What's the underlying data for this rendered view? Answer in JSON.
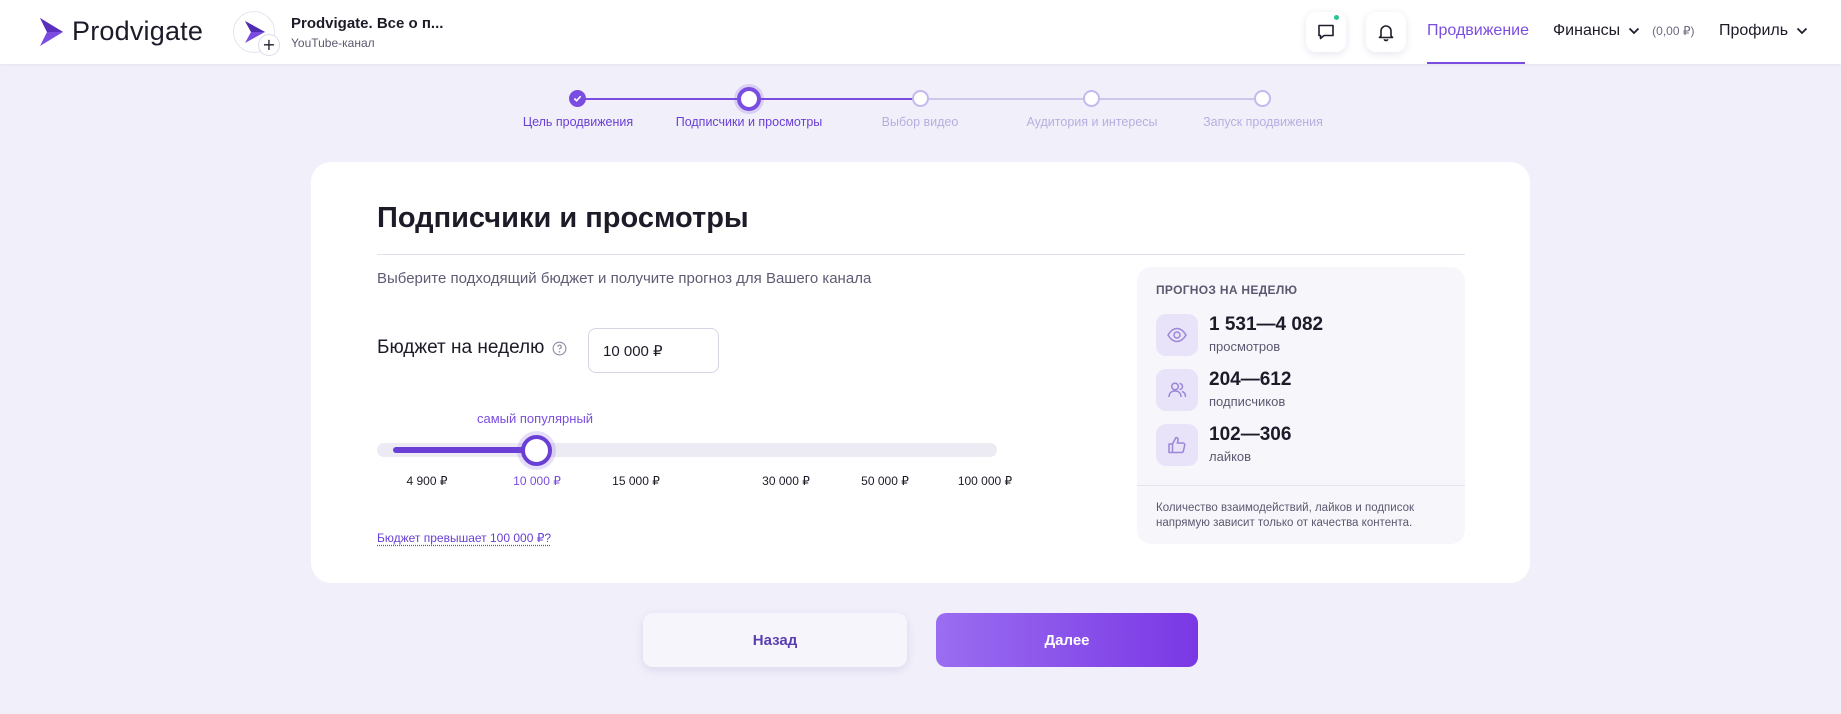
{
  "header": {
    "logo_text": "Prodvigate",
    "channel_name": "Prodvigate. Все о п...",
    "channel_type": "YouTube-канал",
    "channel_add": "+",
    "nav_promo": "Продвижение",
    "nav_finance": "Финансы",
    "finance_amount": "(0,00 ₽)",
    "nav_profile": "Профиль"
  },
  "stepper": {
    "steps": [
      {
        "label": "Цель продвижения",
        "state": "done"
      },
      {
        "label": "Подписчики и просмотры",
        "state": "current"
      },
      {
        "label": "Выбор видео",
        "state": "pending"
      },
      {
        "label": "Аудитория и интересы",
        "state": "pending"
      },
      {
        "label": "Запуск продвижения",
        "state": "pending"
      }
    ]
  },
  "card": {
    "title": "Подписчики и просмотры",
    "subtitle": "Выберите подходящий бюджет и получите прогноз для Вашего канала",
    "budget_label": "Бюджет на неделю",
    "budget_value": "10 000 ₽",
    "popular_label": "самый популярный",
    "slider": {
      "ticks": [
        "4 900 ₽",
        "10 000 ₽",
        "15 000 ₽",
        "30 000 ₽",
        "50 000 ₽",
        "100 000 ₽"
      ],
      "selected": "10 000 ₽"
    },
    "over_budget_link": "Бюджет превышает 100 000 ₽?"
  },
  "forecast": {
    "title": "ПРОГНОЗ НА НЕДЕЛЮ",
    "items": [
      {
        "value": "1 531—4 082",
        "unit": "просмотров",
        "icon": "eye-icon"
      },
      {
        "value": "204—612",
        "unit": "подписчиков",
        "icon": "users-icon"
      },
      {
        "value": "102—306",
        "unit": "лайков",
        "icon": "thumbs-up-icon"
      }
    ],
    "note": "Количество взаимодействий, лайков и подписок напрямую зависит только от качества контента."
  },
  "buttons": {
    "back": "Назад",
    "next": "Далее"
  },
  "colors": {
    "accent": "#7a4de0",
    "accent_dark": "#6a3fd6",
    "background": "#f1f0fa"
  }
}
